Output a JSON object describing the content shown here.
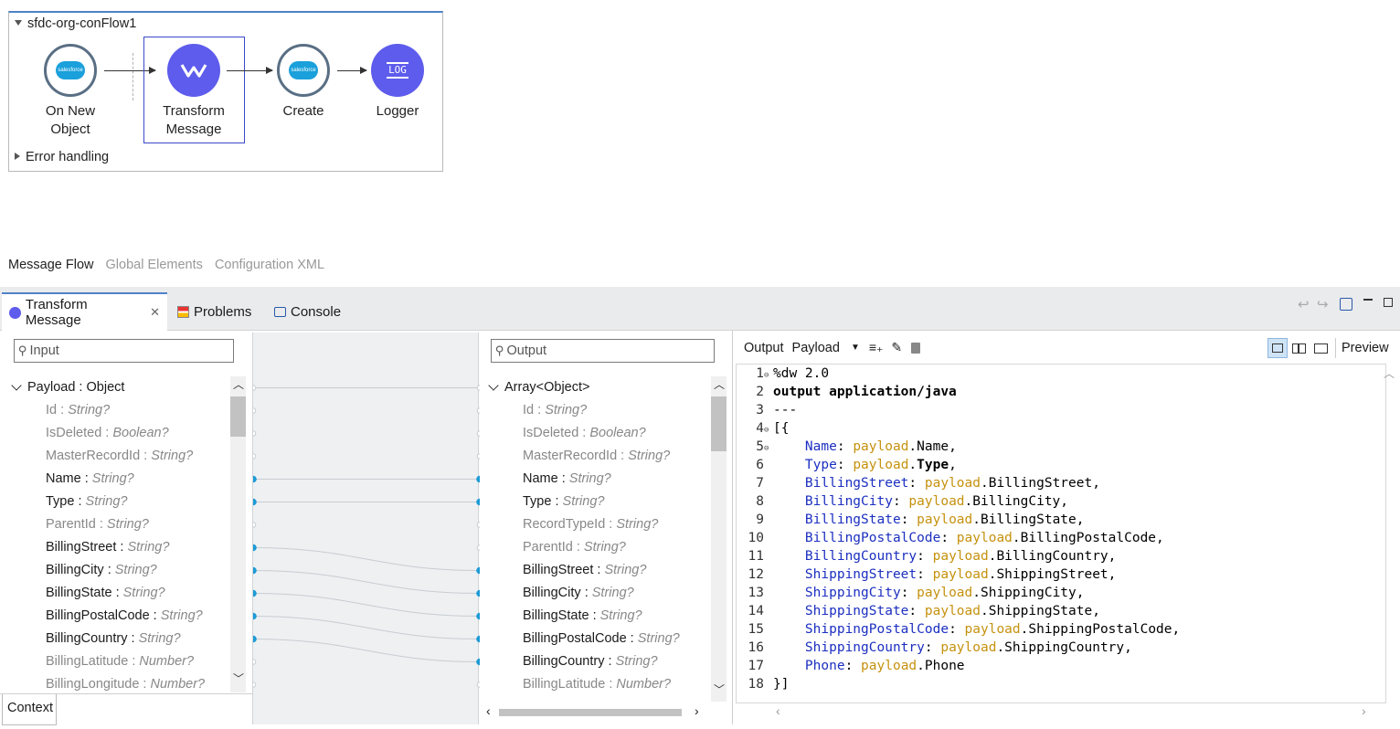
{
  "flow": {
    "title": "sfdc-org-conFlow1",
    "error_handling": "Error handling",
    "nodes": [
      {
        "label1": "On New",
        "label2": "Object",
        "icon_text": "salesforce"
      },
      {
        "label1": "Transform",
        "label2": "Message"
      },
      {
        "label1": "Create",
        "label2": "",
        "icon_text": "salesforce"
      },
      {
        "label1": "Logger",
        "label2": "",
        "icon_text": "LOG"
      }
    ]
  },
  "editor_tabs": [
    "Message Flow",
    "Global Elements",
    "Configuration XML"
  ],
  "panel_tabs": [
    "Transform Message",
    "Problems",
    "Console"
  ],
  "input": {
    "placeholder": "Input",
    "root": "Payload",
    "root_type": "Object",
    "fields": [
      {
        "name": "Id",
        "type": "String?",
        "mapped": false
      },
      {
        "name": "IsDeleted",
        "type": "Boolean?",
        "mapped": false
      },
      {
        "name": "MasterRecordId",
        "type": "String?",
        "mapped": false
      },
      {
        "name": "Name",
        "type": "String?",
        "mapped": true
      },
      {
        "name": "Type",
        "type": "String?",
        "mapped": true
      },
      {
        "name": "ParentId",
        "type": "String?",
        "mapped": false
      },
      {
        "name": "BillingStreet",
        "type": "String?",
        "mapped": true
      },
      {
        "name": "BillingCity",
        "type": "String?",
        "mapped": true
      },
      {
        "name": "BillingState",
        "type": "String?",
        "mapped": true
      },
      {
        "name": "BillingPostalCode",
        "type": "String?",
        "mapped": true
      },
      {
        "name": "BillingCountry",
        "type": "String?",
        "mapped": true
      },
      {
        "name": "BillingLatitude",
        "type": "Number?",
        "mapped": false
      },
      {
        "name": "BillingLongitude",
        "type": "Number?",
        "mapped": false
      }
    ],
    "context_tab": "Context"
  },
  "output": {
    "placeholder": "Output",
    "root": "Array<Object>",
    "fields": [
      {
        "name": "Id",
        "type": "String?",
        "mapped": false
      },
      {
        "name": "IsDeleted",
        "type": "Boolean?",
        "mapped": false
      },
      {
        "name": "MasterRecordId",
        "type": "String?",
        "mapped": false
      },
      {
        "name": "Name",
        "type": "String?",
        "mapped": true
      },
      {
        "name": "Type",
        "type": "String?",
        "mapped": true
      },
      {
        "name": "RecordTypeId",
        "type": "String?",
        "mapped": false
      },
      {
        "name": "ParentId",
        "type": "String?",
        "mapped": false
      },
      {
        "name": "BillingStreet",
        "type": "String?",
        "mapped": true
      },
      {
        "name": "BillingCity",
        "type": "String?",
        "mapped": true
      },
      {
        "name": "BillingState",
        "type": "String?",
        "mapped": true
      },
      {
        "name": "BillingPostalCode",
        "type": "String?",
        "mapped": true
      },
      {
        "name": "BillingCountry",
        "type": "String?",
        "mapped": true
      },
      {
        "name": "BillingLatitude",
        "type": "Number?",
        "mapped": false
      }
    ]
  },
  "script_toolbar": {
    "output_label": "Output",
    "target": "Payload",
    "preview": "Preview"
  },
  "code": [
    {
      "n": "1",
      "fold": true,
      "parts": [
        {
          "c": "plain",
          "t": "%dw 2.0"
        }
      ]
    },
    {
      "n": "2",
      "fold": false,
      "parts": [
        {
          "c": "kw",
          "t": "output application/java"
        }
      ]
    },
    {
      "n": "3",
      "fold": false,
      "parts": [
        {
          "c": "plain",
          "t": "---"
        }
      ]
    },
    {
      "n": "4",
      "fold": true,
      "parts": [
        {
          "c": "plain",
          "t": "[{"
        }
      ]
    },
    {
      "n": "5",
      "fold": true,
      "parts": [
        {
          "c": "plain",
          "t": "    "
        },
        {
          "c": "fld",
          "t": "Name"
        },
        {
          "c": "plain",
          "t": ": "
        },
        {
          "c": "pl",
          "t": "payload"
        },
        {
          "c": "plain",
          "t": ".Name,"
        }
      ]
    },
    {
      "n": "6",
      "fold": false,
      "parts": [
        {
          "c": "plain",
          "t": "    "
        },
        {
          "c": "fld",
          "t": "Type"
        },
        {
          "c": "plain",
          "t": ": "
        },
        {
          "c": "pl",
          "t": "payload"
        },
        {
          "c": "plain",
          "t": "."
        },
        {
          "c": "kw",
          "t": "Type"
        },
        {
          "c": "plain",
          "t": ","
        }
      ]
    },
    {
      "n": "7",
      "fold": false,
      "parts": [
        {
          "c": "plain",
          "t": "    "
        },
        {
          "c": "fld",
          "t": "BillingStreet"
        },
        {
          "c": "plain",
          "t": ": "
        },
        {
          "c": "pl",
          "t": "payload"
        },
        {
          "c": "plain",
          "t": ".BillingStreet,"
        }
      ]
    },
    {
      "n": "8",
      "fold": false,
      "parts": [
        {
          "c": "plain",
          "t": "    "
        },
        {
          "c": "fld",
          "t": "BillingCity"
        },
        {
          "c": "plain",
          "t": ": "
        },
        {
          "c": "pl",
          "t": "payload"
        },
        {
          "c": "plain",
          "t": ".BillingCity,"
        }
      ]
    },
    {
      "n": "9",
      "fold": false,
      "parts": [
        {
          "c": "plain",
          "t": "    "
        },
        {
          "c": "fld",
          "t": "BillingState"
        },
        {
          "c": "plain",
          "t": ": "
        },
        {
          "c": "pl",
          "t": "payload"
        },
        {
          "c": "plain",
          "t": ".BillingState,"
        }
      ]
    },
    {
      "n": "10",
      "fold": false,
      "parts": [
        {
          "c": "plain",
          "t": "    "
        },
        {
          "c": "fld",
          "t": "BillingPostalCode"
        },
        {
          "c": "plain",
          "t": ": "
        },
        {
          "c": "pl",
          "t": "payload"
        },
        {
          "c": "plain",
          "t": ".BillingPostalCode,"
        }
      ]
    },
    {
      "n": "11",
      "fold": false,
      "parts": [
        {
          "c": "plain",
          "t": "    "
        },
        {
          "c": "fld",
          "t": "BillingCountry"
        },
        {
          "c": "plain",
          "t": ": "
        },
        {
          "c": "pl",
          "t": "payload"
        },
        {
          "c": "plain",
          "t": ".BillingCountry,"
        }
      ]
    },
    {
      "n": "12",
      "fold": false,
      "parts": [
        {
          "c": "plain",
          "t": "    "
        },
        {
          "c": "fld",
          "t": "ShippingStreet"
        },
        {
          "c": "plain",
          "t": ": "
        },
        {
          "c": "pl",
          "t": "payload"
        },
        {
          "c": "plain",
          "t": ".ShippingStreet,"
        }
      ]
    },
    {
      "n": "13",
      "fold": false,
      "parts": [
        {
          "c": "plain",
          "t": "    "
        },
        {
          "c": "fld",
          "t": "ShippingCity"
        },
        {
          "c": "plain",
          "t": ": "
        },
        {
          "c": "pl",
          "t": "payload"
        },
        {
          "c": "plain",
          "t": ".ShippingCity,"
        }
      ]
    },
    {
      "n": "14",
      "fold": false,
      "parts": [
        {
          "c": "plain",
          "t": "    "
        },
        {
          "c": "fld",
          "t": "ShippingState"
        },
        {
          "c": "plain",
          "t": ": "
        },
        {
          "c": "pl",
          "t": "payload"
        },
        {
          "c": "plain",
          "t": ".ShippingState,"
        }
      ]
    },
    {
      "n": "15",
      "fold": false,
      "parts": [
        {
          "c": "plain",
          "t": "    "
        },
        {
          "c": "fld",
          "t": "ShippingPostalCode"
        },
        {
          "c": "plain",
          "t": ": "
        },
        {
          "c": "pl",
          "t": "payload"
        },
        {
          "c": "plain",
          "t": ".ShippingPostalCode,"
        }
      ]
    },
    {
      "n": "16",
      "fold": false,
      "parts": [
        {
          "c": "plain",
          "t": "    "
        },
        {
          "c": "fld",
          "t": "ShippingCountry"
        },
        {
          "c": "plain",
          "t": ": "
        },
        {
          "c": "pl",
          "t": "payload"
        },
        {
          "c": "plain",
          "t": ".ShippingCountry,"
        }
      ]
    },
    {
      "n": "17",
      "fold": false,
      "parts": [
        {
          "c": "plain",
          "t": "    "
        },
        {
          "c": "fld",
          "t": "Phone"
        },
        {
          "c": "plain",
          "t": ": "
        },
        {
          "c": "pl",
          "t": "payload"
        },
        {
          "c": "plain",
          "t": ".Phone"
        }
      ]
    },
    {
      "n": "18",
      "fold": false,
      "parts": [
        {
          "c": "plain",
          "t": "}]"
        }
      ]
    }
  ],
  "colors": {
    "accent": "#4e82c8",
    "transform_icon": "#5e5cec",
    "mapping_dot": "#1c9bd6",
    "field_key": "#1c2fc0",
    "payload_keyword": "#c5920f"
  }
}
